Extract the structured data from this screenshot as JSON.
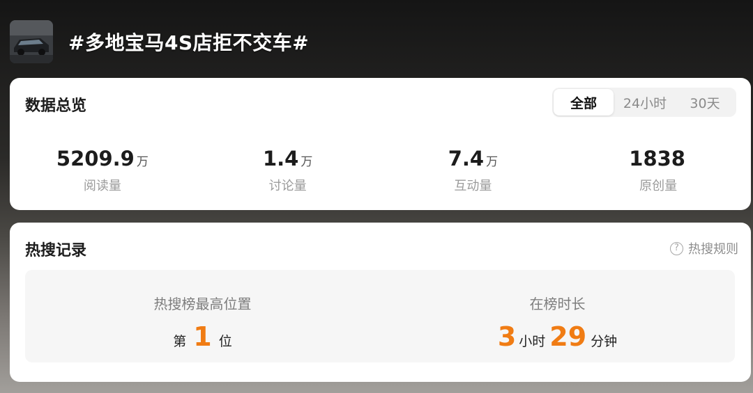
{
  "header": {
    "topic_title": "#多地宝马4S店拒不交车#",
    "thumbnail_icon": "car-thumbnail"
  },
  "overview": {
    "title": "数据总览",
    "tabs": [
      "全部",
      "24小时",
      "30天"
    ],
    "active_tab": "全部",
    "stats": [
      {
        "value": "5209.9",
        "unit": "万",
        "label": "阅读量"
      },
      {
        "value": "1.4",
        "unit": "万",
        "label": "讨论量"
      },
      {
        "value": "7.4",
        "unit": "万",
        "label": "互动量"
      },
      {
        "value": "1838",
        "unit": "",
        "label": "原创量"
      }
    ]
  },
  "hot": {
    "title": "热搜记录",
    "rules_label": "热搜规则",
    "rules_icon": "question-circle-icon",
    "peak": {
      "label": "热搜榜最高位置",
      "prefix": "第",
      "rank": "1",
      "suffix": "位"
    },
    "duration": {
      "label": "在榜时长",
      "hours": "3",
      "hours_unit": "小时",
      "minutes": "29",
      "minutes_unit": "分钟"
    }
  },
  "colors": {
    "accent": "#f07c14",
    "card_bg": "#ffffff",
    "panel_bg": "#f6f6f6"
  }
}
